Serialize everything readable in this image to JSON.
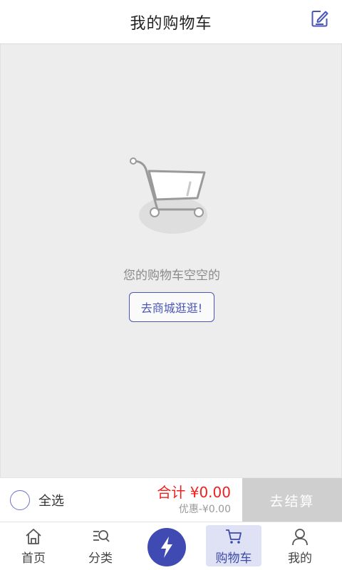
{
  "header": {
    "title": "我的购物车",
    "edit_icon": "edit-icon"
  },
  "empty_state": {
    "illustration": "empty-cart-icon",
    "message": "您的购物车空空的",
    "shop_button_label": "去商城逛逛!"
  },
  "checkout_bar": {
    "select_all_label": "全选",
    "total_label": "合计",
    "total_value": "¥0.00",
    "discount_label": "优惠-",
    "discount_value": "¥0.00",
    "checkout_button_label": "去结算"
  },
  "tabbar": {
    "active_tab": "购物车",
    "items": [
      {
        "label": "首页",
        "icon": "home-icon"
      },
      {
        "label": "分类",
        "icon": "category-icon"
      },
      {
        "label": "",
        "icon": "lightning-icon"
      },
      {
        "label": "购物车",
        "icon": "cart-icon"
      },
      {
        "label": "我的",
        "icon": "user-icon"
      }
    ]
  },
  "colors": {
    "accent": "#3f4bb3",
    "price": "#f01e1e",
    "checkout_disabled": "#cfcfcf",
    "background": "#ededed"
  }
}
